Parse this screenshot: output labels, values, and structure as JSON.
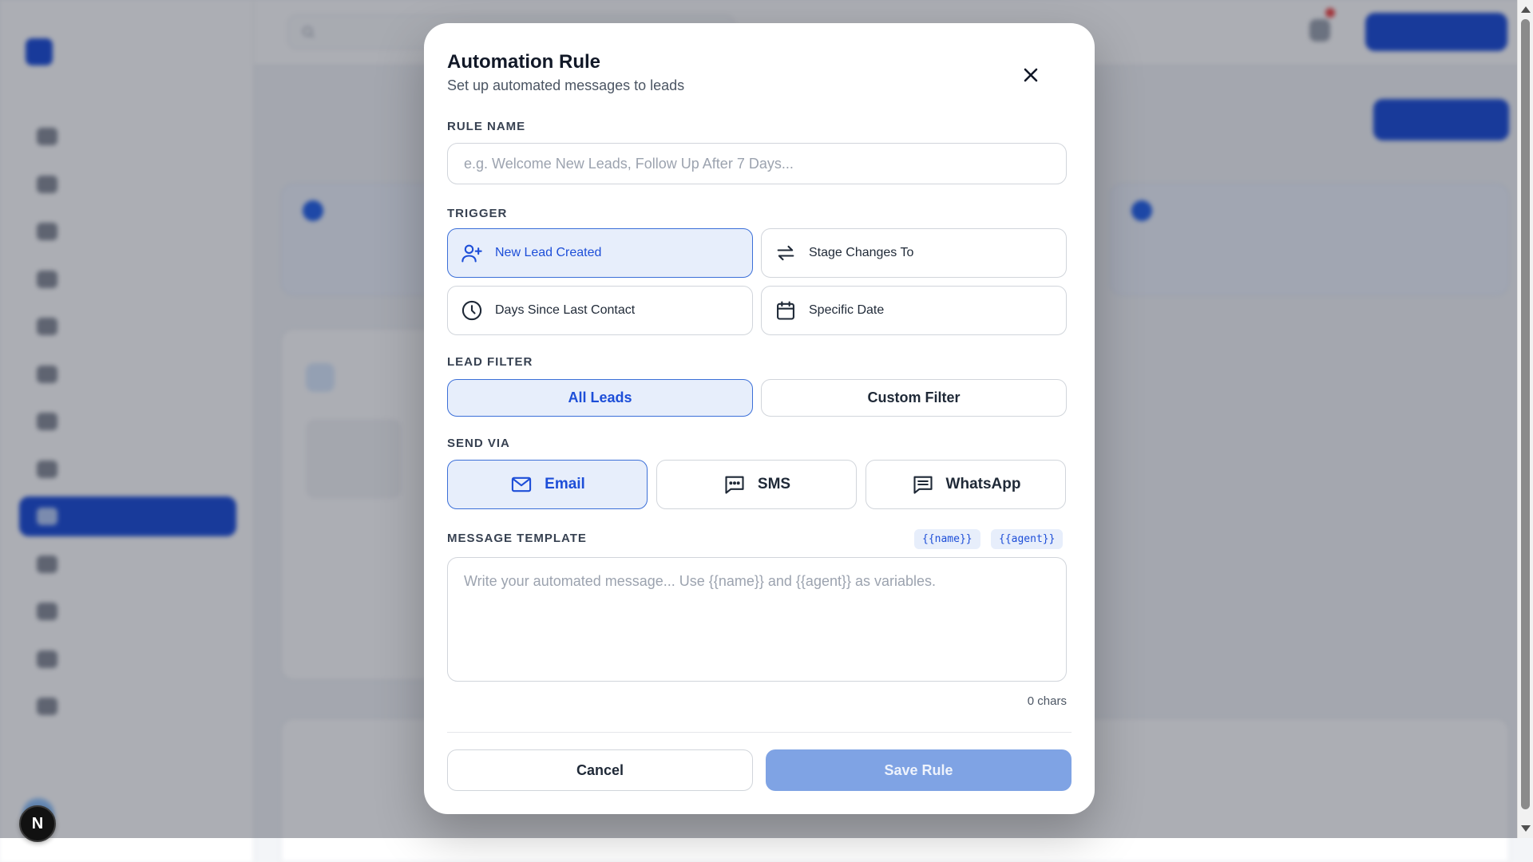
{
  "modal": {
    "title": "Automation Rule",
    "subtitle": "Set up automated messages to leads",
    "close_icon": "close-icon",
    "rule_name": {
      "label": "RULE NAME",
      "value": "",
      "placeholder": "e.g. Welcome New Leads, Follow Up After 7 Days..."
    },
    "trigger": {
      "label": "TRIGGER",
      "selected": "New Lead Created",
      "options": [
        {
          "label": "New Lead Created",
          "icon": "user-plus-icon",
          "selected": true
        },
        {
          "label": "Stage Changes To",
          "icon": "arrows-swap-icon",
          "selected": false
        },
        {
          "label": "Days Since Last Contact",
          "icon": "clock-icon",
          "selected": false
        },
        {
          "label": "Specific Date",
          "icon": "calendar-icon",
          "selected": false
        }
      ]
    },
    "lead_filter": {
      "label": "LEAD FILTER",
      "options": [
        {
          "label": "All Leads",
          "selected": true
        },
        {
          "label": "Custom Filter",
          "selected": false
        }
      ]
    },
    "send_via": {
      "label": "SEND VIA",
      "options": [
        {
          "label": "Email",
          "icon": "mail-icon",
          "selected": true
        },
        {
          "label": "SMS",
          "icon": "message-dots-icon",
          "selected": false
        },
        {
          "label": "WhatsApp",
          "icon": "message-lines-icon",
          "selected": false
        }
      ]
    },
    "message_template": {
      "label": "MESSAGE TEMPLATE",
      "variables": [
        "{{name}}",
        "{{agent}}"
      ],
      "value": "",
      "placeholder": "Write your automated message... Use {{name}} and {{agent}} as variables.",
      "char_count": "0 chars"
    },
    "cancel_label": "Cancel",
    "save_label": "Save Rule"
  },
  "badge": {
    "letter": "N"
  },
  "colors": {
    "accent": "#1d4ed8",
    "selected_bg": "#e7eefb",
    "save_disabled": "#7fa3e4",
    "overlay": "rgba(17,24,39,0.35)"
  }
}
